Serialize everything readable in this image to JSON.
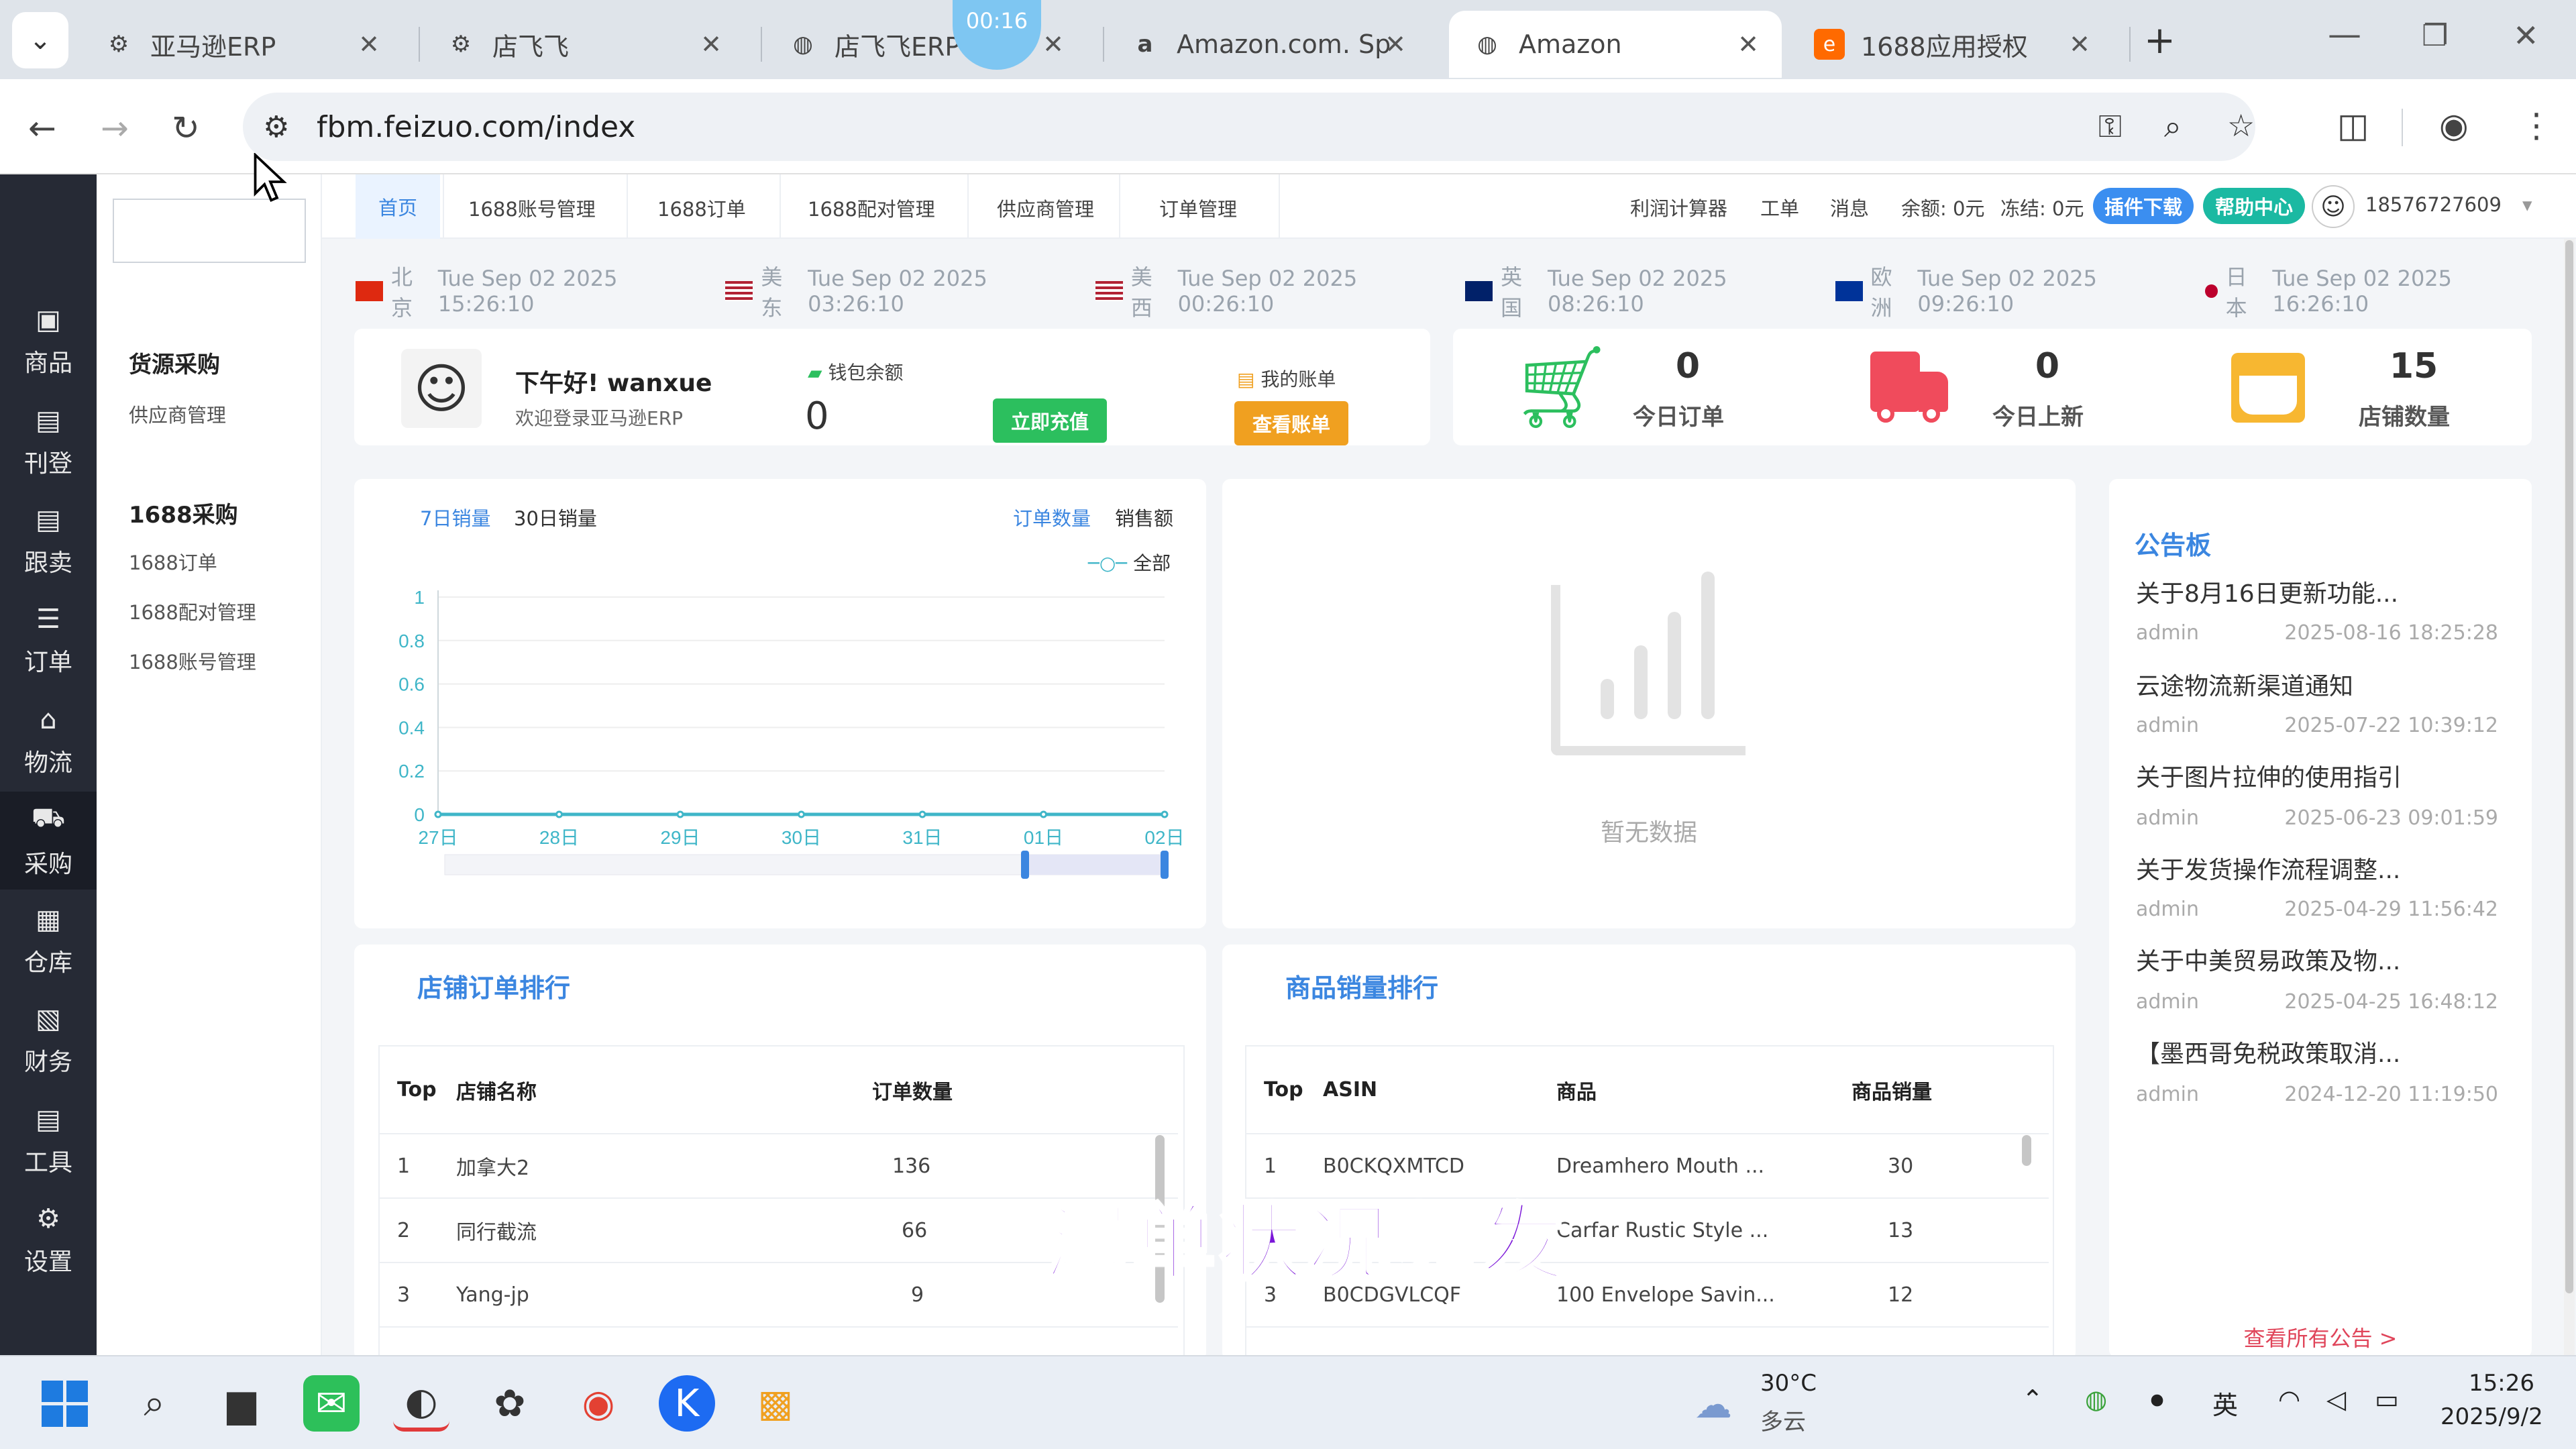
{
  "browser": {
    "tabs": [
      {
        "title": "亚马逊ERP",
        "icon": "erp-icon"
      },
      {
        "title": "店飞飞",
        "icon": "erp-icon"
      },
      {
        "title": "店飞飞ERP",
        "icon": "globe-icon"
      },
      {
        "title": "Amazon.com. Sp",
        "icon": "amazon-icon"
      },
      {
        "title": "Amazon",
        "icon": "globe-icon",
        "active": true
      },
      {
        "title": "1688应用授权",
        "icon": "alibaba-icon"
      }
    ],
    "recording_timer": "00:16",
    "url": "fbm.feizuo.com/index"
  },
  "left_nav": [
    {
      "label": "商品",
      "icon": "box-icon"
    },
    {
      "label": "刊登",
      "icon": "publish-icon"
    },
    {
      "label": "跟卖",
      "icon": "follow-sell-icon"
    },
    {
      "label": "订单",
      "icon": "order-icon"
    },
    {
      "label": "物流",
      "icon": "logistics-icon"
    },
    {
      "label": "采购",
      "icon": "cart-icon",
      "active": true
    },
    {
      "label": "仓库",
      "icon": "warehouse-icon"
    },
    {
      "label": "财务",
      "icon": "finance-icon"
    },
    {
      "label": "工具",
      "icon": "tool-icon"
    },
    {
      "label": "设置",
      "icon": "settings-icon"
    }
  ],
  "sub_nav": {
    "group1": {
      "title": "货源采购",
      "items": [
        "供应商管理"
      ]
    },
    "group2": {
      "title": "1688采购",
      "items": [
        "1688订单",
        "1688配对管理",
        "1688账号管理"
      ]
    }
  },
  "top_nav": {
    "items": [
      "首页",
      "1688账号管理",
      "1688订单",
      "1688配对管理",
      "供应商管理",
      "订单管理"
    ],
    "right": {
      "profit_calc": "利润计算器",
      "ticket": "工单",
      "message": "消息",
      "balance": "余额: 0元",
      "frozen": "冻结: 0元",
      "plugin_btn": "插件下载",
      "help_btn": "帮助中心",
      "phone": "18576727609"
    }
  },
  "clocks": [
    {
      "region": "北京",
      "time": "Tue Sep 02 2025 15:26:10",
      "flag": "cn"
    },
    {
      "region": "美东",
      "time": "Tue Sep 02 2025 03:26:10",
      "flag": "us"
    },
    {
      "region": "美西",
      "time": "Tue Sep 02 2025 00:26:10",
      "flag": "us"
    },
    {
      "region": "英国",
      "time": "Tue Sep 02 2025 08:26:10",
      "flag": "uk"
    },
    {
      "region": "欧洲",
      "time": "Tue Sep 02 2025 09:26:10",
      "flag": "eu"
    },
    {
      "region": "日本",
      "time": "Tue Sep 02 2025 16:26:10",
      "flag": "jp"
    }
  ],
  "welcome": {
    "greeting": "下午好! wanxue",
    "sub": "欢迎登录亚马逊ERP",
    "wallet_label": "钱包余额",
    "wallet_value": "0",
    "recharge_btn": "立即充值",
    "bill_label": "我的账单",
    "bill_btn": "查看账单"
  },
  "stats": [
    {
      "value": "0",
      "label": "今日订单",
      "icon": "cart-icon",
      "color": "#2cbf5e"
    },
    {
      "value": "0",
      "label": "今日上新",
      "icon": "truck-icon",
      "color": "#f04b5c"
    },
    {
      "value": "15",
      "label": "店铺数量",
      "icon": "store-icon",
      "color": "#f7b731"
    }
  ],
  "sales_chart": {
    "tabs": [
      "7日销量",
      "30日销量"
    ],
    "metrics": [
      "订单数量",
      "销售额"
    ],
    "legend": "全部",
    "chart_data": {
      "type": "line",
      "categories": [
        "27日",
        "28日",
        "29日",
        "30日",
        "31日",
        "01日",
        "02日"
      ],
      "series": [
        {
          "name": "全部",
          "values": [
            0,
            0,
            0,
            0,
            0,
            0,
            0
          ]
        }
      ],
      "yticks": [
        "0",
        "0.2",
        "0.4",
        "0.6",
        "0.8",
        "1"
      ],
      "ylim": [
        0,
        1
      ],
      "color": "#3fb6c8"
    }
  },
  "empty_panel": {
    "text": "暂无数据"
  },
  "notices": {
    "title": "公告板",
    "items": [
      {
        "title": "关于8月16日更新功能...",
        "author": "admin",
        "date": "2025-08-16 18:25:28"
      },
      {
        "title": "云途物流新渠道通知",
        "author": "admin",
        "date": "2025-07-22 10:39:12"
      },
      {
        "title": "关于图片拉伸的使用指引",
        "author": "admin",
        "date": "2025-06-23 09:01:59"
      },
      {
        "title": "关于发货操作流程调整...",
        "author": "admin",
        "date": "2025-04-29 11:56:42"
      },
      {
        "title": "关于中美贸易政策及物...",
        "author": "admin",
        "date": "2025-04-25 16:48:12"
      },
      {
        "title": "【墨西哥免税政策取消...",
        "author": "admin",
        "date": "2024-12-20 11:19:50"
      }
    ],
    "view_all": "查看所有公告 >"
  },
  "store_rank": {
    "title": "店铺订单排行",
    "headers": [
      "Top",
      "店铺名称",
      "订单数量"
    ],
    "rows": [
      [
        "1",
        "加拿大2",
        "136"
      ],
      [
        "2",
        "同行截流",
        "66"
      ],
      [
        "3",
        "Yang-jp",
        "9"
      ]
    ]
  },
  "product_rank": {
    "title": "商品销量排行",
    "headers": [
      "Top",
      "ASIN",
      "商品",
      "商品销量"
    ],
    "rows": [
      [
        "1",
        "B0CKQXMTCD",
        "Dreamhero Mouth ...",
        "30"
      ],
      [
        "2",
        "",
        "Carfar Rustic Style ...",
        "13"
      ],
      [
        "3",
        "B0CDGVLCQF",
        "100 Envelope Savin...",
        "12"
      ]
    ]
  },
  "video_subtitle": "漏单状况频发",
  "taskbar": {
    "weather_temp": "30°C",
    "weather_desc": "多云",
    "ime": "英",
    "time": "15:26",
    "date": "2025/9/2"
  }
}
